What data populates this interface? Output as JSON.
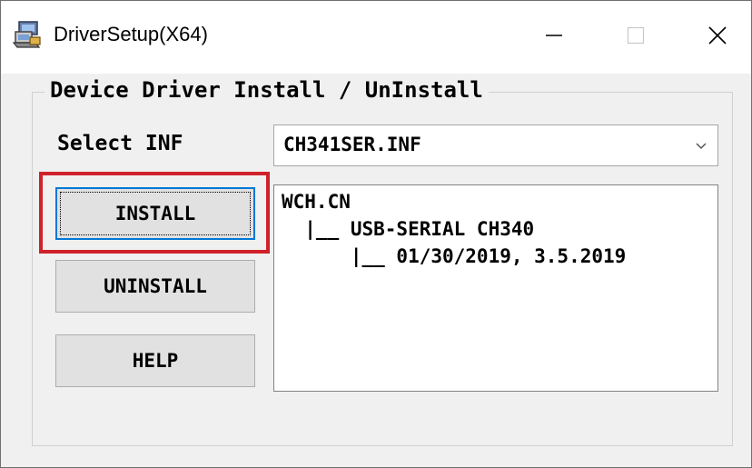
{
  "window": {
    "title": "DriverSetup(X64)",
    "icons": {
      "app": "driver-setup-icon",
      "minimize": "minimize-icon",
      "maximize": "maximize-icon",
      "close": "close-icon"
    }
  },
  "group": {
    "title": "Device Driver Install / UnInstall"
  },
  "select_inf": {
    "label": "Select INF",
    "value": "CH341SER.INF"
  },
  "buttons": {
    "install": "INSTALL",
    "uninstall": "UNINSTALL",
    "help": "HELP"
  },
  "info_tree": {
    "lines": [
      "WCH.CN",
      "  |__ USB-SERIAL CH340",
      "      |__ 01/30/2019, 3.5.2019"
    ]
  },
  "colors": {
    "highlight": "#d0202a",
    "focus_border": "#0078d7"
  }
}
